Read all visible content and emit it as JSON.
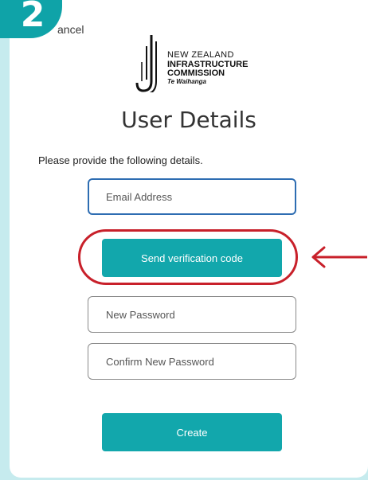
{
  "step": {
    "number": "2"
  },
  "header": {
    "cancel_label": "ancel"
  },
  "logo": {
    "line1": "NEW ZEALAND",
    "line2": "INFRASTRUCTURE",
    "line3": "COMMISSION",
    "line4": "Te Waihanga"
  },
  "page": {
    "title": "User Details",
    "instructions": "Please provide the following details."
  },
  "form": {
    "email_placeholder": "Email Address",
    "send_code_label": "Send verification code",
    "new_password_placeholder": "New Password",
    "confirm_password_placeholder": "Confirm New Password",
    "create_label": "Create"
  },
  "colors": {
    "page_background": "#c6ebee",
    "accent": "#12a7ac",
    "step_badge": "#0fa3a8",
    "highlight": "#c8202a",
    "focus_border": "#2e6db2"
  },
  "icons": {
    "step_badge": "step-number-badge",
    "annotation_arrow": "arrow-left-icon",
    "logo_mark": "nzic-logo-mark"
  }
}
